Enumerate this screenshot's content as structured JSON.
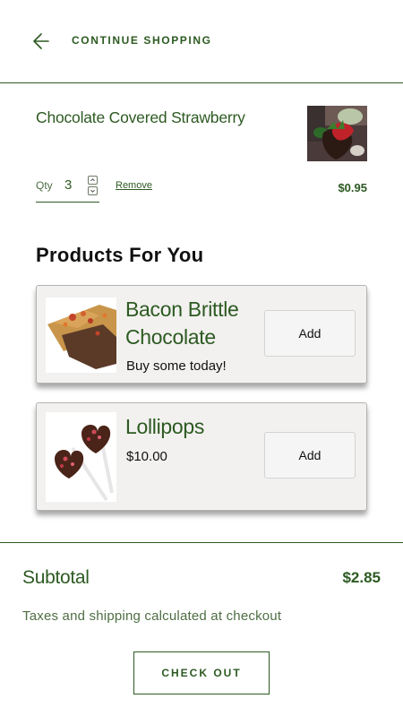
{
  "header": {
    "continue_label": "CONTINUE SHOPPING",
    "back_icon": "arrow-left-icon"
  },
  "cart_item": {
    "title": "Chocolate Covered Strawberry",
    "qty_label": "Qty",
    "qty_value": "3",
    "remove_label": "Remove",
    "price": "$0.95"
  },
  "recommendations": {
    "title": "Products For You",
    "items": [
      {
        "title": "Bacon Brittle Chocolate",
        "subtitle": "Buy some today!",
        "add_label": "Add"
      },
      {
        "title": "Lollipops",
        "subtitle": "$10.00",
        "add_label": "Add"
      }
    ]
  },
  "summary": {
    "subtotal_label": "Subtotal",
    "subtotal_value": "$2.85",
    "tax_note": "Taxes and shipping calculated at checkout",
    "checkout_label": "CHECK OUT"
  },
  "colors": {
    "brand_green": "#2d5a22",
    "card_bg": "#f2f1ef",
    "button_bg": "#f5f5f5"
  }
}
